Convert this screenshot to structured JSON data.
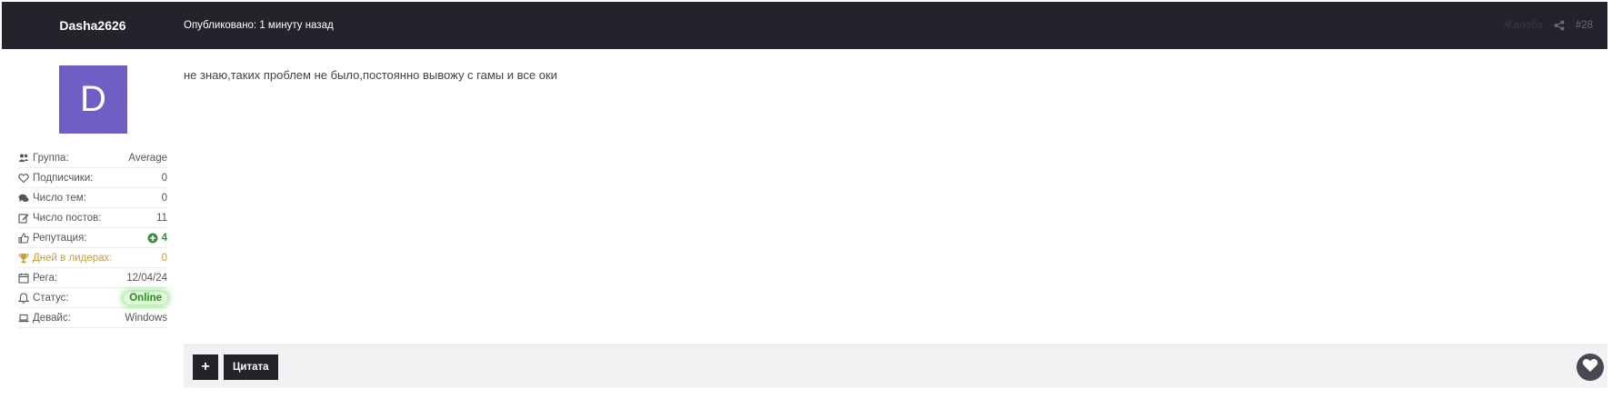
{
  "header": {
    "author": "Dasha2626",
    "published": "Опубликовано: 1 минуту назад",
    "report": "Жалоба",
    "post_number": "#28"
  },
  "sidebar": {
    "avatar_letter": "D",
    "avatar_color": "#6e5fc4",
    "stats": [
      {
        "icon": "users-icon",
        "label": "Группа:",
        "value": "Average"
      },
      {
        "icon": "heart-outline-icon",
        "label": "Подписчики:",
        "value": "0"
      },
      {
        "icon": "comments-icon",
        "label": "Число тем:",
        "value": "0"
      },
      {
        "icon": "edit-icon",
        "label": "Число постов:",
        "value": "11"
      },
      {
        "icon": "thumbs-up-icon",
        "label": "Репутация:",
        "value": "4"
      },
      {
        "icon": "trophy-icon",
        "label": "Дней в лидерах:",
        "value": "0"
      },
      {
        "icon": "calendar-icon",
        "label": "Рега:",
        "value": "12/04/24"
      },
      {
        "icon": "bell-icon",
        "label": "Статус:",
        "value": "Online"
      },
      {
        "icon": "laptop-icon",
        "label": "Девайс:",
        "value": "Windows"
      }
    ]
  },
  "post": {
    "text": "не знаю,таких проблем не было,постоянно вывожу с гамы и все оки"
  },
  "footer": {
    "plus_label": "+",
    "quote_label": "Цитата"
  },
  "colors": {
    "header_bg": "#25222c",
    "reputation": "#3e8d3e",
    "gold": "#c8a03a",
    "online": "#2e8b1e"
  }
}
